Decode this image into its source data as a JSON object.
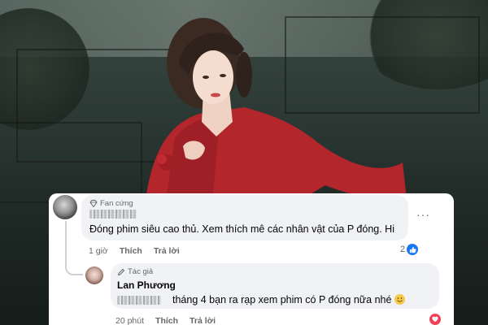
{
  "comments": [
    {
      "badge": "Fan cứng",
      "text": "Đóng phim siêu cao thủ. Xem thích mê các nhân vật của P đóng. Hi",
      "time": "1 giờ",
      "like_label": "Thích",
      "reply_label": "Trả lời",
      "reaction_count": "2",
      "reaction_icon": "like-icon"
    },
    {
      "badge": "Tác giả",
      "author": "Lan Phương",
      "text": "tháng 4 bạn ra rạp xem phim có P đóng nữa nhé",
      "time": "20 phút",
      "like_label": "Thích",
      "reply_label": "Trả lời",
      "reaction_icon": "love-icon"
    }
  ],
  "colors": {
    "link_blue": "#1877f2",
    "love_red": "#f33e58",
    "bubble_bg": "#f0f2f5",
    "dress_red": "#b3262b"
  }
}
